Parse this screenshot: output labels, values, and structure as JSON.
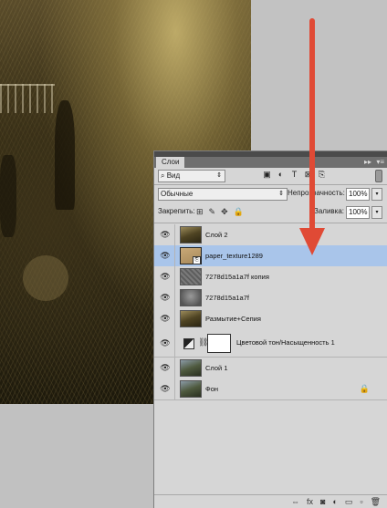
{
  "panel": {
    "tab_label": "Слои",
    "collapse_glyph": "▸▸",
    "menu_glyph": "▾≡"
  },
  "filter": {
    "label": "Вид",
    "search_glyph": "⌕",
    "icons": [
      "image-icon",
      "circle-half-icon",
      "type-icon",
      "transform-icon",
      "smart-object-icon"
    ],
    "icon_glyphs": [
      "▣",
      "◐",
      "T",
      "⊠",
      "⎘"
    ]
  },
  "blend": {
    "mode": "Обычные",
    "opacity_label": "Непрозрачность:",
    "opacity_value": "100%"
  },
  "locks": {
    "label": "Закрепить:",
    "icon_glyphs": [
      "⊞",
      "✎",
      "✥",
      "🔒"
    ],
    "fill_label": "Заливка:",
    "fill_value": "100%"
  },
  "layers": [
    {
      "name": "Слой 2",
      "thumb": "photo",
      "selected": false
    },
    {
      "name": "paper_texture1289",
      "thumb": "paper",
      "selected": true,
      "smart": true
    },
    {
      "name": "7278d15a1a7f копия",
      "thumb": "gray",
      "selected": false
    },
    {
      "name": "7278d15a1a7f",
      "thumb": "gray2",
      "selected": false
    },
    {
      "name": "Размытие+Сепия",
      "thumb": "photo",
      "selected": false
    },
    {
      "name": "Цветовой тон/Насыщенность 1",
      "thumb": "adjustment",
      "selected": false
    },
    {
      "name": "Слой 1",
      "thumb": "color",
      "selected": false
    },
    {
      "name": "Фон",
      "thumb": "color",
      "selected": false,
      "locked": true
    }
  ],
  "bottom_icons": {
    "glyphs": [
      "⇔",
      "fx",
      "◙",
      "◐",
      "▭",
      "▫",
      "🗑"
    ],
    "names": [
      "link-layers-icon",
      "fx-icon",
      "add-mask-icon",
      "new-adjustment-icon",
      "new-group-icon",
      "new-layer-icon",
      "trash-icon"
    ]
  },
  "colors": {
    "selected_row": "#a9c5ea",
    "arrow": "#e04a35"
  }
}
